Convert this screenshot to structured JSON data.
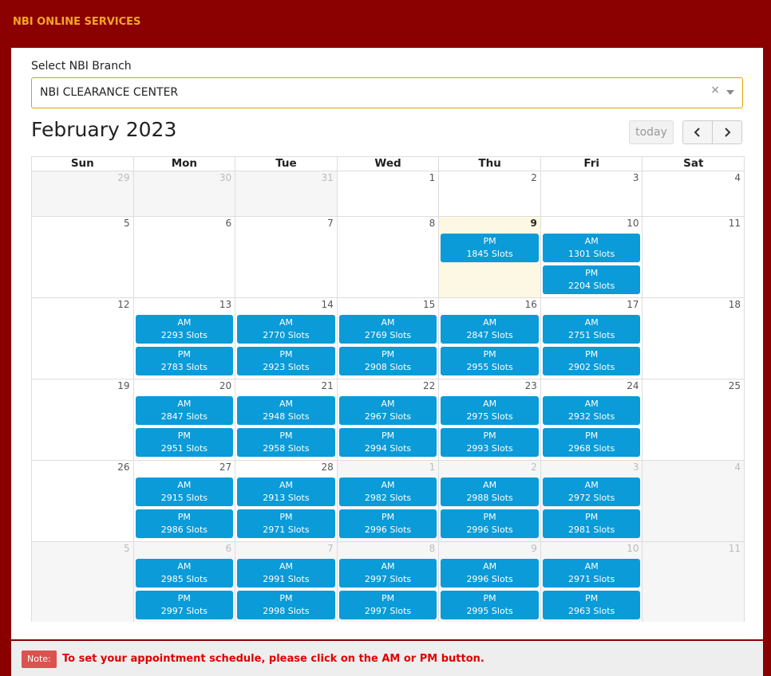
{
  "header": {
    "title": "NBI ONLINE SERVICES"
  },
  "branch": {
    "label": "Select NBI Branch",
    "value": "NBI CLEARANCE CENTER",
    "clear_icon": "×"
  },
  "calendar": {
    "title": "February 2023",
    "today_label": "today",
    "prev_icon": "chevron-left-icon",
    "next_icon": "chevron-right-icon",
    "days_of_week": [
      "Sun",
      "Mon",
      "Tue",
      "Wed",
      "Thu",
      "Fri",
      "Sat"
    ],
    "slot_color": "#0a9bd8",
    "today_color": "#fdf8e3",
    "weeks": [
      [
        {
          "num": "29",
          "other": true
        },
        {
          "num": "30",
          "other": true
        },
        {
          "num": "31",
          "other": true
        },
        {
          "num": "1"
        },
        {
          "num": "2"
        },
        {
          "num": "3"
        },
        {
          "num": "4"
        }
      ],
      [
        {
          "num": "5"
        },
        {
          "num": "6"
        },
        {
          "num": "7"
        },
        {
          "num": "8"
        },
        {
          "num": "9",
          "today": true,
          "slots": [
            {
              "period": "PM",
              "count": "1845 Slots"
            }
          ]
        },
        {
          "num": "10",
          "slots": [
            {
              "period": "AM",
              "count": "1301 Slots"
            },
            {
              "period": "PM",
              "count": "2204 Slots"
            }
          ]
        },
        {
          "num": "11"
        }
      ],
      [
        {
          "num": "12"
        },
        {
          "num": "13",
          "slots": [
            {
              "period": "AM",
              "count": "2293 Slots"
            },
            {
              "period": "PM",
              "count": "2783 Slots"
            }
          ]
        },
        {
          "num": "14",
          "slots": [
            {
              "period": "AM",
              "count": "2770 Slots"
            },
            {
              "period": "PM",
              "count": "2923 Slots"
            }
          ]
        },
        {
          "num": "15",
          "slots": [
            {
              "period": "AM",
              "count": "2769 Slots"
            },
            {
              "period": "PM",
              "count": "2908 Slots"
            }
          ]
        },
        {
          "num": "16",
          "slots": [
            {
              "period": "AM",
              "count": "2847 Slots"
            },
            {
              "period": "PM",
              "count": "2955 Slots"
            }
          ]
        },
        {
          "num": "17",
          "slots": [
            {
              "period": "AM",
              "count": "2751 Slots"
            },
            {
              "period": "PM",
              "count": "2902 Slots"
            }
          ]
        },
        {
          "num": "18"
        }
      ],
      [
        {
          "num": "19"
        },
        {
          "num": "20",
          "slots": [
            {
              "period": "AM",
              "count": "2847 Slots"
            },
            {
              "period": "PM",
              "count": "2951 Slots"
            }
          ]
        },
        {
          "num": "21",
          "slots": [
            {
              "period": "AM",
              "count": "2948 Slots"
            },
            {
              "period": "PM",
              "count": "2958 Slots"
            }
          ]
        },
        {
          "num": "22",
          "slots": [
            {
              "period": "AM",
              "count": "2967 Slots"
            },
            {
              "period": "PM",
              "count": "2994 Slots"
            }
          ]
        },
        {
          "num": "23",
          "slots": [
            {
              "period": "AM",
              "count": "2975 Slots"
            },
            {
              "period": "PM",
              "count": "2993 Slots"
            }
          ]
        },
        {
          "num": "24",
          "slots": [
            {
              "period": "AM",
              "count": "2932 Slots"
            },
            {
              "period": "PM",
              "count": "2968 Slots"
            }
          ]
        },
        {
          "num": "25"
        }
      ],
      [
        {
          "num": "26"
        },
        {
          "num": "27",
          "slots": [
            {
              "period": "AM",
              "count": "2915 Slots"
            },
            {
              "period": "PM",
              "count": "2986 Slots"
            }
          ]
        },
        {
          "num": "28",
          "slots": [
            {
              "period": "AM",
              "count": "2913 Slots"
            },
            {
              "period": "PM",
              "count": "2971 Slots"
            }
          ]
        },
        {
          "num": "1",
          "other": true,
          "slots": [
            {
              "period": "AM",
              "count": "2982 Slots"
            },
            {
              "period": "PM",
              "count": "2996 Slots"
            }
          ]
        },
        {
          "num": "2",
          "other": true,
          "slots": [
            {
              "period": "AM",
              "count": "2988 Slots"
            },
            {
              "period": "PM",
              "count": "2996 Slots"
            }
          ]
        },
        {
          "num": "3",
          "other": true,
          "slots": [
            {
              "period": "AM",
              "count": "2972 Slots"
            },
            {
              "period": "PM",
              "count": "2981 Slots"
            }
          ]
        },
        {
          "num": "4",
          "other": true
        }
      ],
      [
        {
          "num": "5",
          "other": true
        },
        {
          "num": "6",
          "other": true,
          "slots": [
            {
              "period": "AM",
              "count": "2985 Slots"
            },
            {
              "period": "PM",
              "count": "2997 Slots"
            }
          ]
        },
        {
          "num": "7",
          "other": true,
          "slots": [
            {
              "period": "AM",
              "count": "2991 Slots"
            },
            {
              "period": "PM",
              "count": "2998 Slots"
            }
          ]
        },
        {
          "num": "8",
          "other": true,
          "slots": [
            {
              "period": "AM",
              "count": "2997 Slots"
            },
            {
              "period": "PM",
              "count": "2997 Slots"
            }
          ]
        },
        {
          "num": "9",
          "other": true,
          "slots": [
            {
              "period": "AM",
              "count": "2996 Slots"
            },
            {
              "period": "PM",
              "count": "2995 Slots"
            }
          ]
        },
        {
          "num": "10",
          "other": true,
          "slots": [
            {
              "period": "AM",
              "count": "2971 Slots"
            },
            {
              "period": "PM",
              "count": "2963 Slots"
            }
          ]
        },
        {
          "num": "11",
          "other": true
        }
      ]
    ]
  },
  "note": {
    "badge": "Note:",
    "text": "To set your appointment schedule, please click on the AM or PM button."
  }
}
